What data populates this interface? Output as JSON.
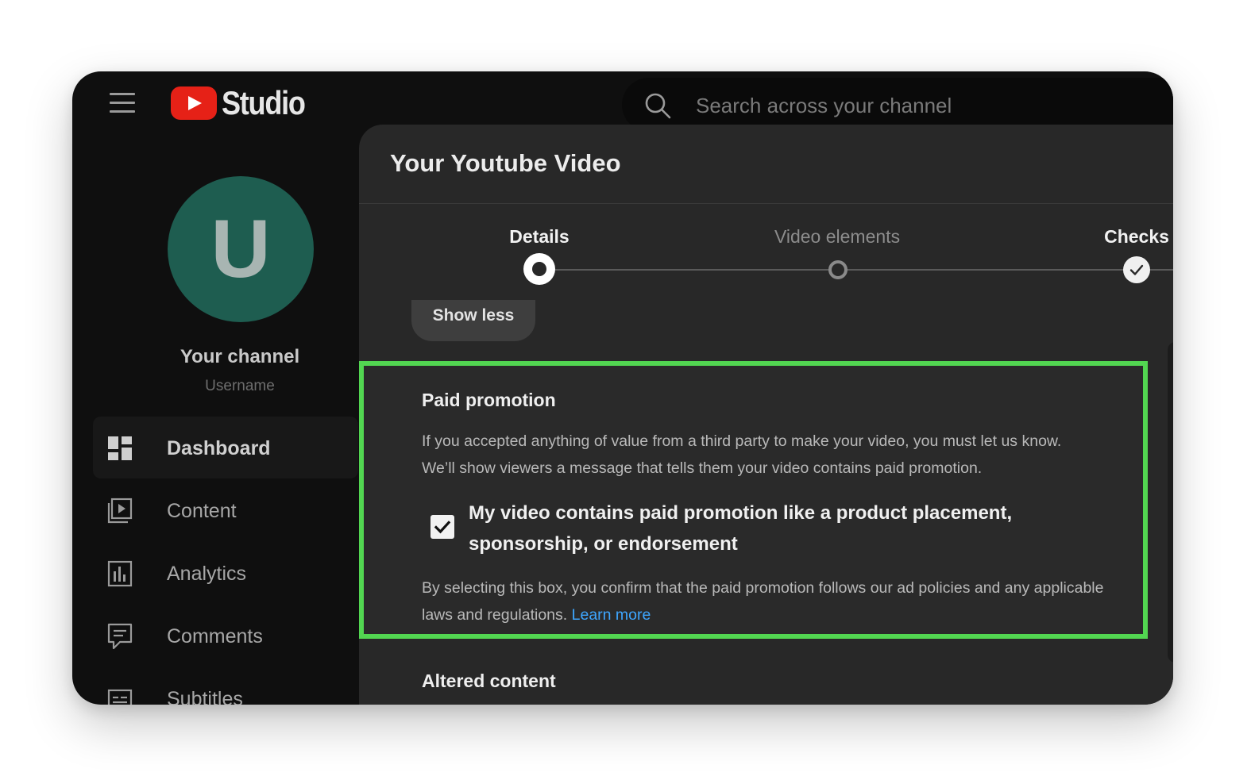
{
  "header": {
    "logo_text": "Studio",
    "search_placeholder": "Search across your channel"
  },
  "sidebar": {
    "avatar_letter": "U",
    "channel_title": "Your channel",
    "channel_username": "Username",
    "items": [
      {
        "label": "Dashboard",
        "icon": "dashboard-icon",
        "active": true
      },
      {
        "label": "Content",
        "icon": "content-icon",
        "active": false
      },
      {
        "label": "Analytics",
        "icon": "analytics-icon",
        "active": false
      },
      {
        "label": "Comments",
        "icon": "comments-icon",
        "active": false
      },
      {
        "label": "Subtitles",
        "icon": "subtitles-icon",
        "active": false
      }
    ]
  },
  "dialog": {
    "title": "Your Youtube Video",
    "steps": [
      {
        "label": "Details",
        "state": "current"
      },
      {
        "label": "Video elements",
        "state": "upcoming"
      },
      {
        "label": "Checks",
        "state": "done"
      }
    ],
    "show_less_label": "Show less",
    "paid_promotion": {
      "title": "Paid promotion",
      "description_line1": "If you accepted anything of value from a third party to make your video, you must let us know.",
      "description_line2": "We’ll show viewers a message that tells them your video contains paid promotion.",
      "checkbox_checked": true,
      "checkbox_label": "My video contains paid promotion like a product placement, sponsorship, or endorsement",
      "note_text": "By selecting this box, you confirm that the paid promotion follows our ad policies and any applicable laws and regulations.",
      "learn_more_label": "Learn more"
    },
    "altered_content_title": "Altered content"
  },
  "colors": {
    "background": "#0f0f0f",
    "dialog": "#282828",
    "highlight_border": "#52d651",
    "link": "#3ea6ff",
    "avatar": "#1e5d50",
    "logo_red": "#e62117"
  }
}
